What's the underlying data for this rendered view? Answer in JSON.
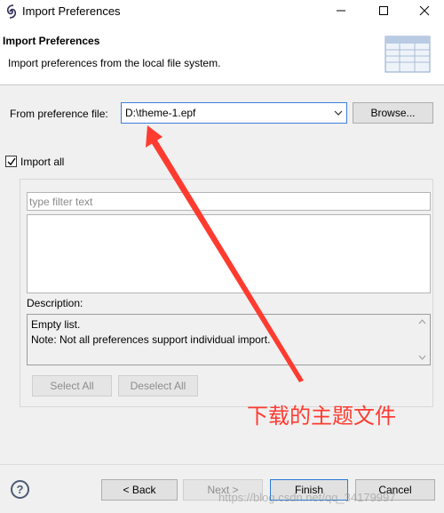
{
  "window": {
    "title": "Import Preferences",
    "icon": "eclipse-app-icon",
    "controls": {
      "minimize": "—",
      "maximize": "□",
      "close": "✕"
    }
  },
  "header": {
    "title": "Import Preferences",
    "description": "Import preferences from the local file system.",
    "icon": "wizard-banner-icon"
  },
  "form": {
    "from_label": "From preference file:",
    "file_value": "D:\\theme-1.epf",
    "browse_label": "Browse...",
    "import_all_label": "Import all",
    "import_all_checked": true
  },
  "filter": {
    "placeholder": "type filter text"
  },
  "description": {
    "label": "Description:",
    "line1": "Empty list.",
    "line2": "Note: Not all preferences support individual import."
  },
  "selection_buttons": {
    "select_all": "Select All",
    "deselect_all": "Deselect All"
  },
  "footer": {
    "help": "?",
    "back": "< Back",
    "next": "Next >",
    "finish": "Finish",
    "cancel": "Cancel"
  },
  "annotation": {
    "text": "下载的主题文件",
    "color": "#ff3b30"
  },
  "watermark": {
    "text": "https://blog.csdn.net/qq_34179997"
  },
  "colors": {
    "accent": "#3a7ed9",
    "annotation": "#ff3b30"
  }
}
